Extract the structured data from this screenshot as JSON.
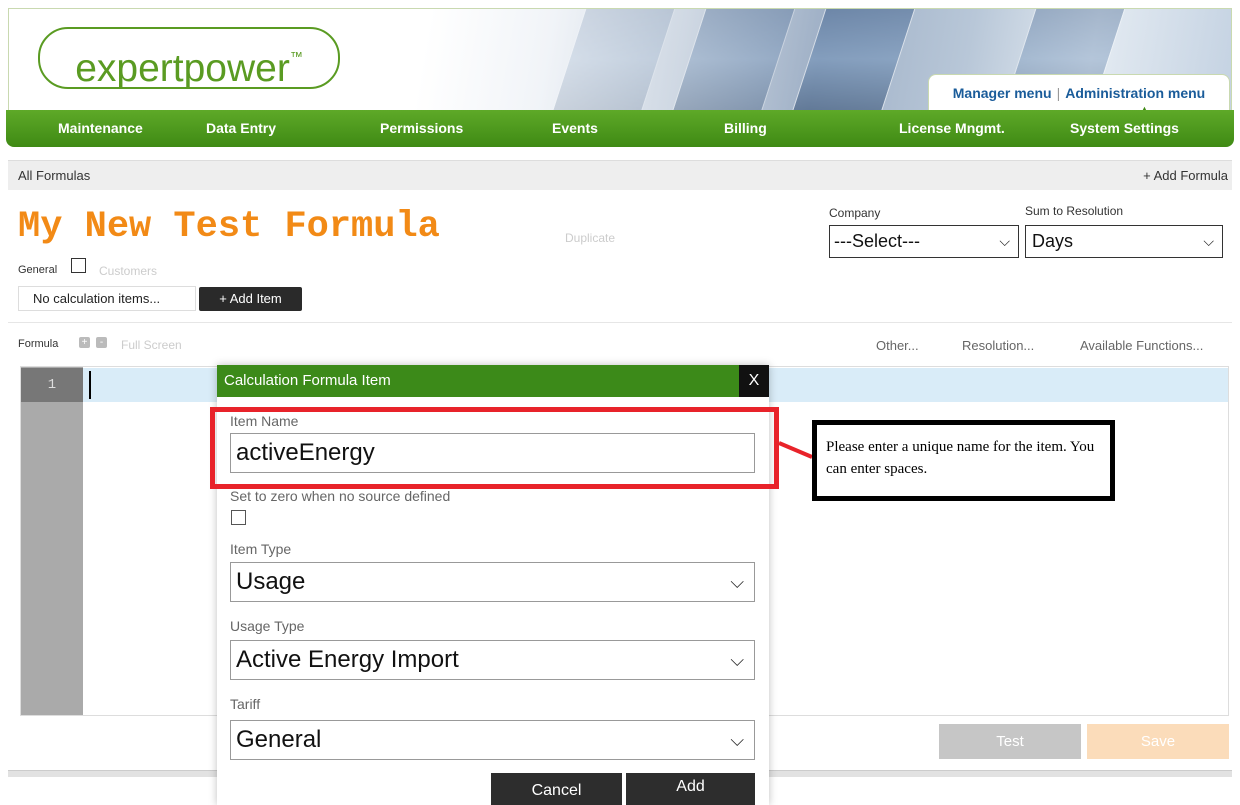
{
  "header": {
    "logo_text": "expertpower",
    "logo_tm": "™",
    "manager_menu": "Manager menu",
    "separator": "|",
    "admin_menu": "Administration menu",
    "caret": "▲"
  },
  "nav": {
    "items": [
      "Maintenance",
      "Data Entry",
      "Permissions",
      "Events",
      "Billing",
      "License Mngmt.",
      "System Settings"
    ]
  },
  "crumb": {
    "all_formulas": "All Formulas",
    "add_formula": "+ Add Formula"
  },
  "formula": {
    "title": "My New Test Formula",
    "duplicate": "Duplicate",
    "general_label": "General",
    "customers": "Customers",
    "no_calc_items": "No calculation items...",
    "add_item": "+ Add Item"
  },
  "filters": {
    "company_label": "Company",
    "company_value": "---Select---",
    "sum_label": "Sum to Resolution",
    "sum_value": "Days",
    "chevron": "⌵"
  },
  "toolbar": {
    "formula_label": "Formula",
    "plus": "+",
    "minus": "-",
    "full_screen": "Full Screen",
    "other": "Other...",
    "resolution": "Resolution...",
    "available_functions": "Available Functions..."
  },
  "editor": {
    "line_number": "1"
  },
  "actions": {
    "test": "Test",
    "save": "Save"
  },
  "dialog": {
    "title": "Calculation Formula Item",
    "close": "X",
    "item_name_label": "Item Name",
    "item_name_value": "activeEnergy",
    "zero_label": "Set to zero when no source defined",
    "item_type_label": "Item Type",
    "item_type_value": "Usage",
    "usage_type_label": "Usage Type",
    "usage_type_value": "Active Energy Import",
    "tariff_label": "Tariff",
    "tariff_value": "General",
    "chevron": "⌵",
    "cancel": "Cancel",
    "add": "Add"
  },
  "annotation": {
    "callout_text": "Please enter a unique name for the item. You can enter spaces.",
    "highlight_color": "#e8232a"
  },
  "colors": {
    "brand_green": "#3f8a14",
    "title_orange": "#f28a16",
    "link_blue": "#1a5c9a"
  }
}
